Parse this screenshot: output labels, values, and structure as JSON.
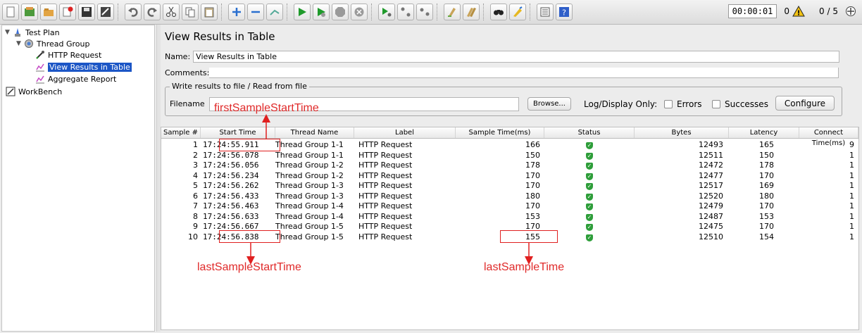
{
  "toolbar": {
    "timer": "00:00:01",
    "warning_count": "0",
    "threads": "0 / 5"
  },
  "tree": {
    "test_plan": "Test Plan",
    "thread_group": "Thread Group",
    "http_request": "HTTP Request",
    "view_results": "View Results in Table",
    "aggregate_report": "Aggregate Report",
    "workbench": "WorkBench"
  },
  "panel": {
    "title": "View Results in Table",
    "name_label": "Name:",
    "name_value": "View Results in Table",
    "comments_label": "Comments:",
    "file_legend": "Write results to file / Read from file",
    "filename_label": "Filename",
    "filename_value": "",
    "browse_button": "Browse...",
    "log_display_label": "Log/Display Only:",
    "errors_label": "Errors",
    "successes_label": "Successes",
    "configure_button": "Configure"
  },
  "table": {
    "columns": [
      "Sample #",
      "Start Time",
      "Thread Name",
      "Label",
      "Sample Time(ms)",
      "Status",
      "Bytes",
      "Latency",
      "Connect Time(ms)"
    ],
    "rows": [
      [
        "1",
        "17:24:55.911",
        "Thread Group 1-1",
        "HTTP Request",
        "166",
        "12493",
        "165",
        "9"
      ],
      [
        "2",
        "17:24:56.078",
        "Thread Group 1-1",
        "HTTP Request",
        "150",
        "12511",
        "150",
        "1"
      ],
      [
        "3",
        "17:24:56.056",
        "Thread Group 1-2",
        "HTTP Request",
        "178",
        "12472",
        "178",
        "1"
      ],
      [
        "4",
        "17:24:56.234",
        "Thread Group 1-2",
        "HTTP Request",
        "170",
        "12477",
        "170",
        "1"
      ],
      [
        "5",
        "17:24:56.262",
        "Thread Group 1-3",
        "HTTP Request",
        "170",
        "12517",
        "169",
        "1"
      ],
      [
        "6",
        "17:24:56.433",
        "Thread Group 1-3",
        "HTTP Request",
        "180",
        "12520",
        "180",
        "1"
      ],
      [
        "7",
        "17:24:56.463",
        "Thread Group 1-4",
        "HTTP Request",
        "170",
        "12479",
        "170",
        "1"
      ],
      [
        "8",
        "17:24:56.633",
        "Thread Group 1-4",
        "HTTP Request",
        "153",
        "12487",
        "153",
        "1"
      ],
      [
        "9",
        "17:24:56.667",
        "Thread Group 1-5",
        "HTTP Request",
        "170",
        "12475",
        "170",
        "1"
      ],
      [
        "10",
        "17:24:56.838",
        "Thread Group 1-5",
        "HTTP Request",
        "155",
        "12510",
        "154",
        "1"
      ]
    ]
  },
  "annotations": {
    "first_sample_start": "firstSampleStartTime",
    "last_sample_start": "lastSampleStartTime",
    "last_sample_time": "lastSampleTime",
    "color": "#e02020"
  },
  "colors": {
    "selection": "#1c56c6",
    "status_ok": "#2e9e3a"
  }
}
